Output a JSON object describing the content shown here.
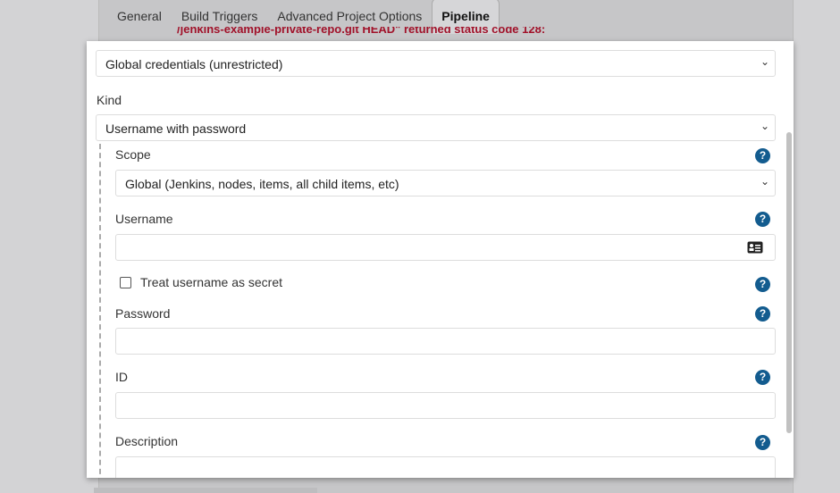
{
  "tabs": [
    {
      "label": "General"
    },
    {
      "label": "Build Triggers"
    },
    {
      "label": "Advanced Project Options"
    },
    {
      "label": "Pipeline",
      "active": true
    }
  ],
  "background_error": "/jenkins-example-private-repo.git HEAD\" returned status code 128:",
  "form": {
    "domain_select": "Global credentials (unrestricted)",
    "kind_label": "Kind",
    "kind_select": "Username with password",
    "scope_label": "Scope",
    "scope_select": "Global (Jenkins, nodes, items, all child items, etc)",
    "username_label": "Username",
    "username_value": "",
    "treat_secret_label": "Treat username as secret",
    "treat_secret_checked": false,
    "password_label": "Password",
    "password_value": "",
    "id_label": "ID",
    "id_value": "",
    "description_label": "Description",
    "description_value": ""
  },
  "icons": {
    "help": "question-circle-icon",
    "chevron": "chevron-down-icon",
    "contact": "id-card-icon"
  },
  "colors": {
    "help": "#135c8f",
    "error": "#a1122a"
  }
}
